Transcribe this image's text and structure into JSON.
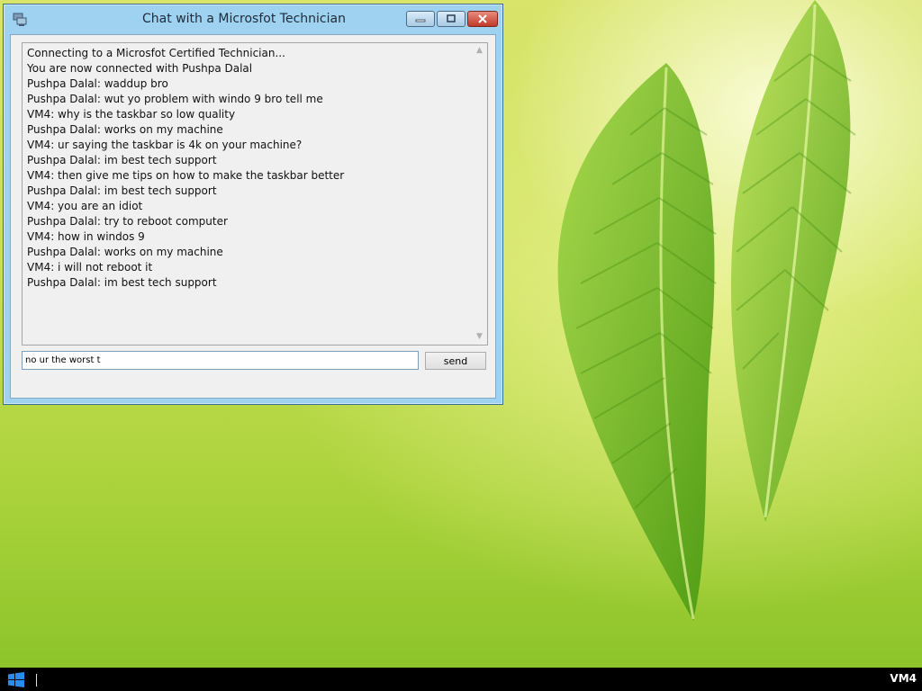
{
  "window": {
    "title": "Chat with a Microsfot Technician",
    "app_icon": "network-users-icon",
    "controls": {
      "minimize_icon": "minimize-icon",
      "maximize_icon": "maximize-icon",
      "close_icon": "close-icon"
    }
  },
  "chat": {
    "lines": [
      "Connecting to a Microsfot Certified Technician...",
      "You are now connected with Pushpa Dalal",
      "Pushpa Dalal: waddup bro",
      "Pushpa Dalal: wut yo problem with windo 9 bro tell me",
      "VM4: why is the taskbar so low quality",
      "Pushpa Dalal: works on my machine",
      "VM4: ur saying the taskbar is 4k on your machine?",
      "Pushpa Dalal: im best tech support",
      "VM4: then give me tips on how to make the taskbar better",
      "Pushpa Dalal: im best tech support",
      "VM4: you are an idiot",
      "Pushpa Dalal: try to reboot computer",
      "VM4: how in windos 9",
      "Pushpa Dalal: works on my machine",
      "VM4: i will not reboot it",
      "Pushpa Dalal: im best tech support"
    ]
  },
  "composer": {
    "input_value": "no ur the worst t",
    "send_label": "send"
  },
  "taskbar": {
    "start_icon": "windows-logo-icon",
    "machine_label": "VM4"
  },
  "colors": {
    "window_frame": "#9ed2f0",
    "taskbar": "#000000",
    "start_logo": "#1e90ff",
    "close_button": "#c0392b"
  }
}
